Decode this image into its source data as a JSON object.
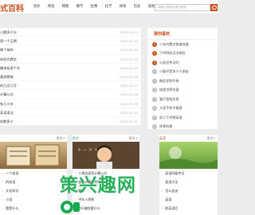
{
  "header": {
    "logo": "式百科",
    "nav": [
      "语文",
      "英语",
      "物理",
      "数学",
      "生物",
      "化学",
      "体育",
      "历史",
      "其他"
    ],
    "search_placeholder": "请输入搜索关键词搜索"
  },
  "main_list": {
    "items": [
      {
        "title": "小题多少分",
        "date": "2025-01-01"
      },
      {
        "title": "第一个王朝",
        "date": "2025-01-02"
      },
      {
        "title": "哪个城市",
        "date": "2025-01-03"
      },
      {
        "title": "体验式教学",
        "date": "2025-01-04"
      },
      {
        "title": "编排各家个名",
        "date": "2025-01-05"
      },
      {
        "title": "素质教育",
        "date": "2025-01-06"
      },
      {
        "title": "的几点几号",
        "date": "2025-01-07"
      },
      {
        "title": "计算公式",
        "date": "2025-01-08"
      },
      {
        "title": "有几十年",
        "date": "2025-01-09"
      },
      {
        "title": "英语语法",
        "date": "2025-01-10"
      },
      {
        "title": "倍数多少",
        "date": "2025-01-11"
      }
    ]
  },
  "recommend": {
    "title": "猜你喜欢",
    "items": [
      {
        "num": "1",
        "text": "二年内蒙古铁道技能"
      },
      {
        "num": "2",
        "text": "下YAD的汉字哪些"
      },
      {
        "num": "3",
        "text": "公务员考试的"
      },
      {
        "num": "4",
        "text": "小猴子是多少人朋友"
      },
      {
        "num": "5",
        "text": "微信学院不带"
      },
      {
        "num": "6",
        "text": "烧饭世界名著"
      },
      {
        "num": "7",
        "text": "客厅是啥作用"
      },
      {
        "num": "8",
        "text": "大家手机平板我"
      },
      {
        "num": "9",
        "text": "初二下学期英语"
      },
      {
        "num": "10",
        "text": "体育科普"
      }
    ]
  },
  "cards": [
    {
      "label": "",
      "more": "更多>",
      "items": [
        "一个成语",
        "的成语",
        "文化知识",
        "小说",
        "题是什么"
      ]
    },
    {
      "label": "数学",
      "more": "更多>",
      "items": [
        "二角形面积计算公式",
        "剧目计算机考研",
        "数学",
        "中年人阴影",
        "PLC编程要什么"
      ]
    },
    {
      "label": "英语",
      "more": "更多>",
      "items": [
        "英语四级考试",
        "英语大全",
        "怎么加油",
        "英语",
        "职英语后"
      ]
    }
  ],
  "watermark": "策兴趣网",
  "colors": {
    "accent": "#c8521a",
    "green": "#18aa50"
  }
}
